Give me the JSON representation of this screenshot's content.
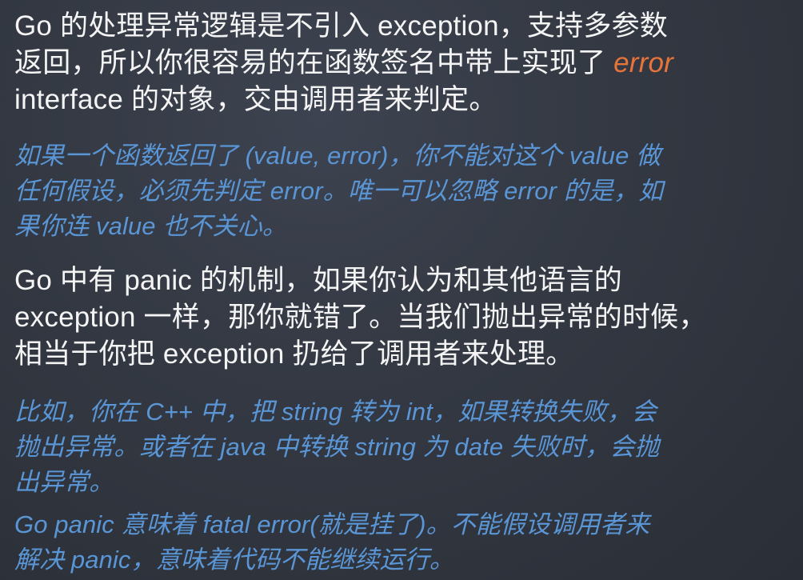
{
  "slide": {
    "para1": {
      "line1": "Go 的处理异常逻辑是不引入 exception，支持多参数",
      "line2_prefix": "返回，所以你很容易的在函数签名中带上实现了 ",
      "line2_accent": "error",
      "line3": "interface 的对象，交由调用者来判定。"
    },
    "note1": {
      "line1": "如果一个函数返回了 (value, error)，你不能对这个 value 做",
      "line2": "任何假设，必须先判定 error。唯一可以忽略 error 的是，如",
      "line3": "果你连 value 也不关心。"
    },
    "para2": {
      "line1": "Go 中有 panic 的机制，如果你认为和其他语言的",
      "line2": "exception 一样，那你就错了。当我们抛出异常的时候，",
      "line3": "相当于你把 exception 扔给了调用者来处理。"
    },
    "note2": {
      "line1": "比如，你在 C++ 中，把 string 转为 int，如果转换失败，会",
      "line2": "抛出异常。或者在 java 中转换 string 为 date 失败时，会抛",
      "line3": "出异常。"
    },
    "note3": {
      "line1": "Go panic 意味着 fatal error(就是挂了)。不能假设调用者来",
      "line2": "解决 panic，意味着代码不能继续运行。"
    }
  },
  "colors": {
    "background": "#333842",
    "body_text": "#f4f4f4",
    "note_text": "#5a96d6",
    "accent": "#e8743a"
  }
}
